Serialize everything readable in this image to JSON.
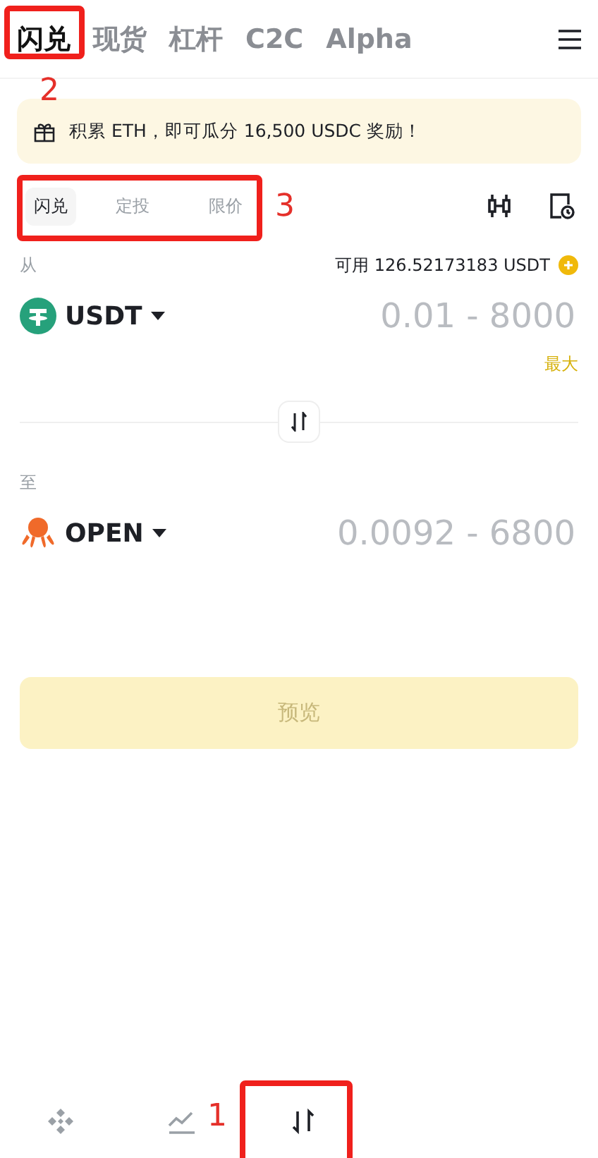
{
  "tabs": [
    {
      "label": "闪兑",
      "selected": true
    },
    {
      "label": "现货",
      "selected": false
    },
    {
      "label": "杠杆",
      "selected": false
    },
    {
      "label": "C2C",
      "selected": false
    },
    {
      "label": "Alpha",
      "selected": false
    }
  ],
  "banner": {
    "text": "积累 ETH，即可瓜分 16,500 USDC 奖励！"
  },
  "convert_tabs": [
    {
      "label": "闪兑",
      "selected": true
    },
    {
      "label": "定投",
      "selected": false
    },
    {
      "label": "限价",
      "selected": false
    }
  ],
  "from": {
    "label": "从",
    "available": "可用 126.52173183 USDT",
    "token": "USDT",
    "placeholder": "0.01 - 8000",
    "max": "最大"
  },
  "to": {
    "label": "至",
    "token": "OPEN",
    "placeholder": "0.0092 - 6800"
  },
  "preview_button": {
    "label": "预览",
    "disabled": true
  },
  "bottom_nav": [
    {
      "kind": "home",
      "selected": false
    },
    {
      "kind": "markets",
      "selected": false
    },
    {
      "kind": "trade",
      "selected": true
    }
  ],
  "annotations": [
    {
      "label": "2"
    },
    {
      "label": "3"
    },
    {
      "label": "1"
    }
  ]
}
